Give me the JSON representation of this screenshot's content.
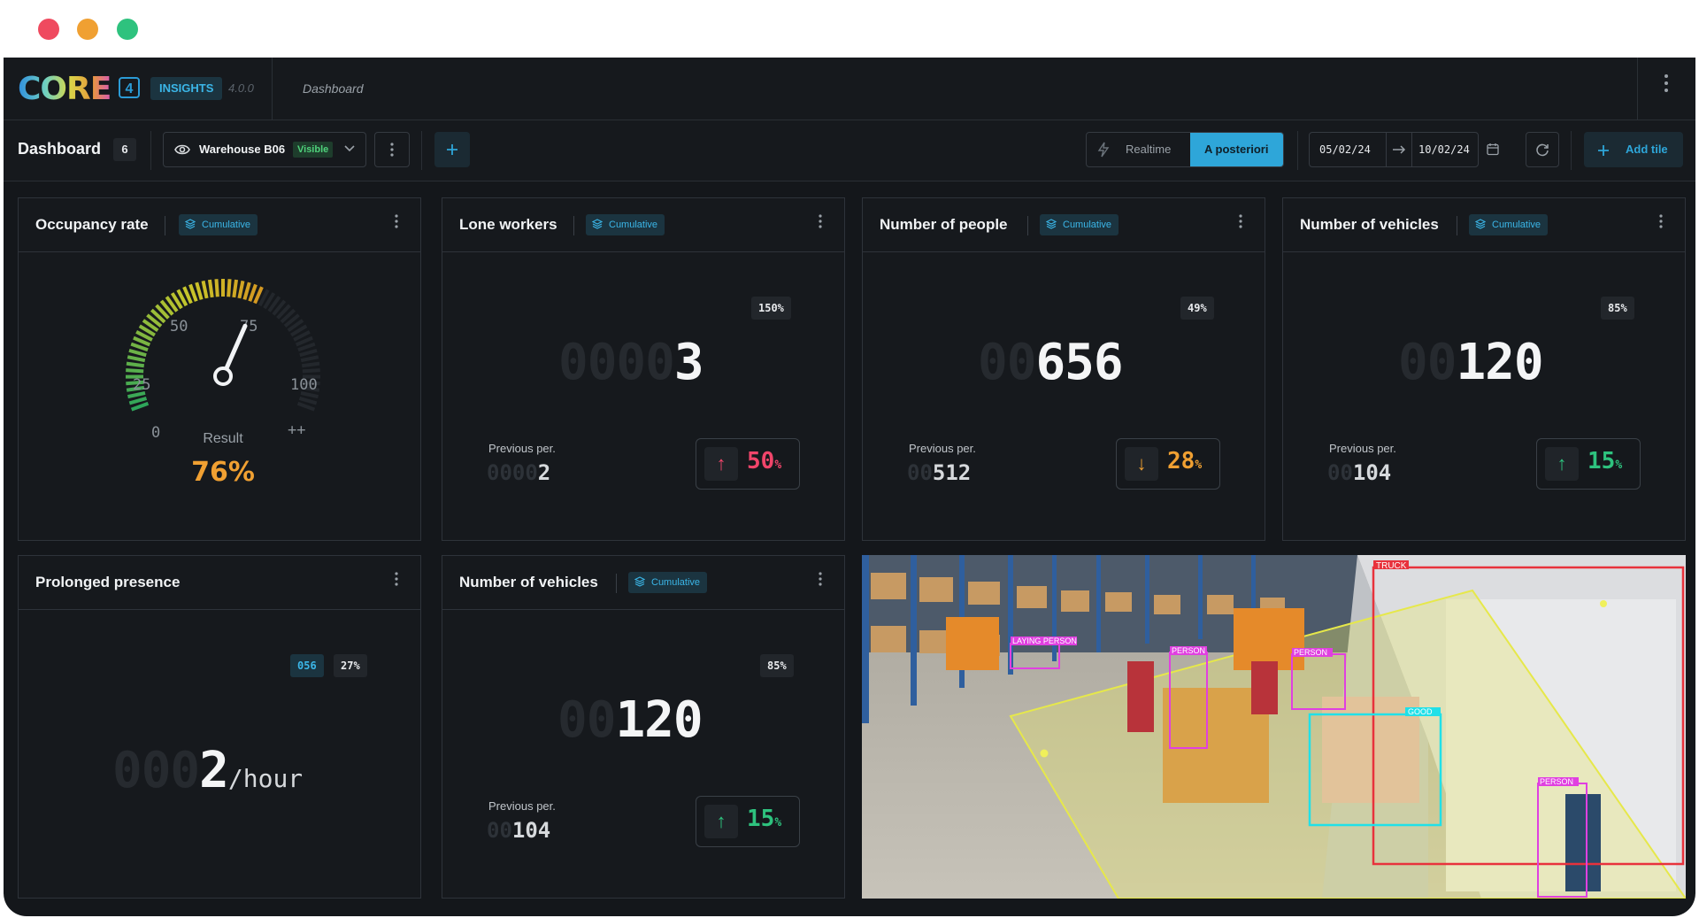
{
  "window": {
    "dots": [
      "#ef4a5f",
      "#f0a032",
      "#2ec27e"
    ]
  },
  "topbar": {
    "logo": "CORE",
    "logo_badge": "4",
    "product": "INSIGHTS",
    "version": "4.0.0",
    "breadcrumb": "Dashboard"
  },
  "toolbar": {
    "title": "Dashboard",
    "count": "6",
    "view": {
      "name": "Warehouse B06",
      "visibility": "Visible"
    },
    "mode_realtime": "Realtime",
    "mode_aposteriori": "A posteriori",
    "date_from": "05/02/24",
    "date_to": "10/02/24",
    "add_tile": "Add tile"
  },
  "tiles": {
    "occupancy": {
      "title": "Occupancy rate",
      "tag": "Cumulative",
      "gauge_labels": [
        "0",
        "25",
        "50",
        "75",
        "100",
        "++"
      ],
      "result_label": "Result",
      "result_value": "76%",
      "result_fraction": 0.76
    },
    "lone_workers": {
      "title": "Lone workers",
      "tag": "Cumulative",
      "badge": "150%",
      "value_ghost": "0000",
      "value": "3",
      "prev_label": "Previous per.",
      "prev_ghost": "0000",
      "prev_value": "2",
      "delta": "50",
      "delta_unit": "%",
      "delta_dir": "up"
    },
    "people": {
      "title": "Number of people",
      "tag": "Cumulative",
      "badge": "49%",
      "value_ghost": "00",
      "value": "656",
      "prev_label": "Previous per.",
      "prev_ghost": "00",
      "prev_value": "512",
      "delta": "28",
      "delta_unit": "%",
      "delta_dir": "down"
    },
    "vehicles1": {
      "title": "Number of vehicles",
      "tag": "Cumulative",
      "badge": "85%",
      "value_ghost": "00",
      "value": "120",
      "prev_label": "Previous per.",
      "prev_ghost": "00",
      "prev_value": "104",
      "delta": "15",
      "delta_unit": "%",
      "delta_dir": "up"
    },
    "prolonged": {
      "title": "Prolonged presence",
      "badge_blue": "056",
      "badge": "27%",
      "value_ghost": "000",
      "value": "2",
      "unit": "/hour"
    },
    "vehicles2": {
      "title": "Number of vehicles",
      "tag": "Cumulative",
      "badge": "85%",
      "value_ghost": "00",
      "value": "120",
      "prev_label": "Previous per.",
      "prev_ghost": "00",
      "prev_value": "104",
      "delta": "15",
      "delta_unit": "%",
      "delta_dir": "up"
    },
    "camera": {
      "detections": [
        "TRUCK",
        "LAYING PERSON",
        "PERSON",
        "PERSON",
        "GOOD",
        "PERSON"
      ]
    }
  },
  "colors": {
    "accent": "#2ea6d9",
    "up_red": "#f0456a",
    "down_orange": "#f0a032",
    "up_green": "#2ec27e",
    "result": "#f0a032"
  }
}
